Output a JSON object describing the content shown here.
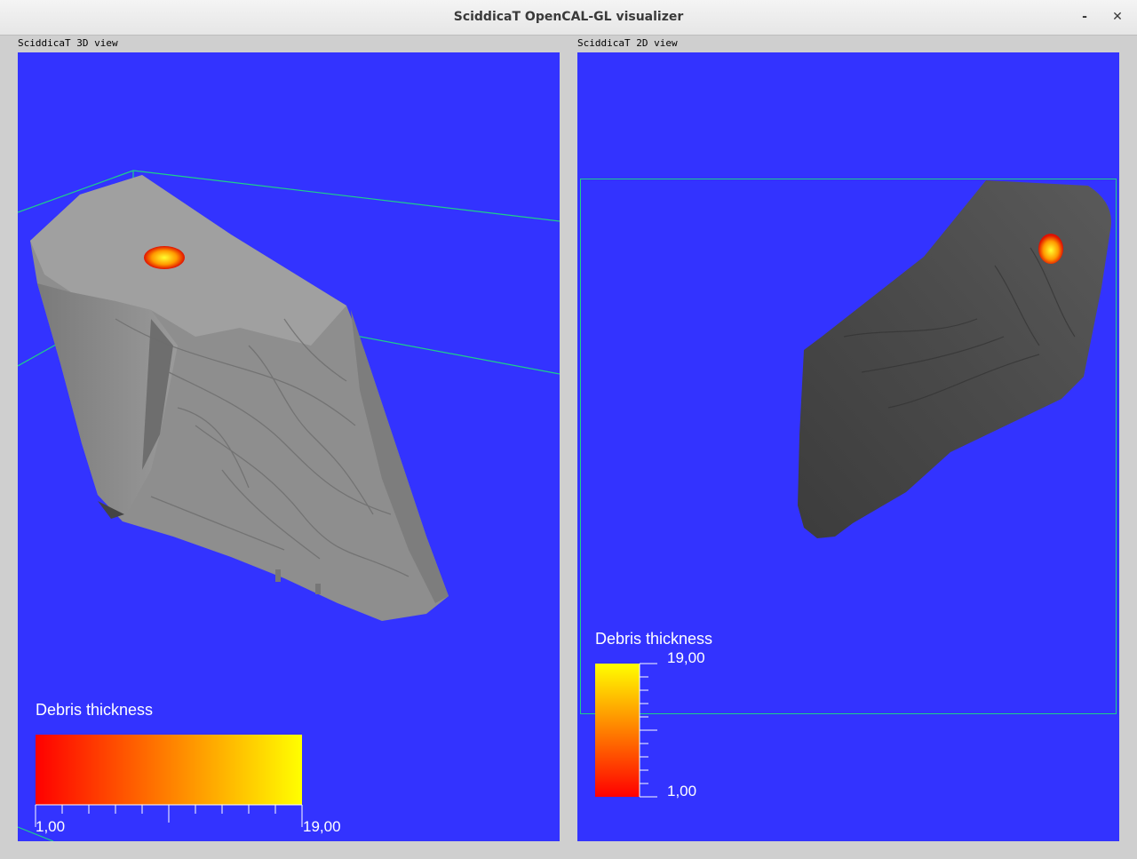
{
  "window": {
    "title": "SciddicaT OpenCAL-GL visualizer",
    "minimize_glyph": "-",
    "close_glyph": "✕"
  },
  "view3d": {
    "caption": "SciddicaT 3D view",
    "legend": {
      "title": "Debris thickness",
      "min_label": "1,00",
      "max_label": "19,00",
      "orientation": "horizontal"
    }
  },
  "view2d": {
    "caption": "SciddicaT 2D view",
    "legend": {
      "title": "Debris thickness",
      "max_label": "19,00",
      "min_label": "1,00",
      "orientation": "vertical"
    }
  },
  "colors": {
    "background": "#3333ff",
    "bounding_box": "#1ecf8a",
    "terrain_3d": "#8e8e8e",
    "terrain_2d": "#4a4a4a",
    "scale_low": "#ff0000",
    "scale_high": "#ffff00"
  }
}
